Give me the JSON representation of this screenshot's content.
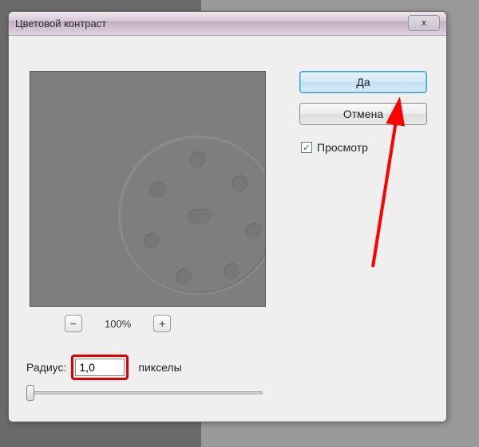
{
  "dialog": {
    "title": "Цветовой контраст",
    "close_icon": "x"
  },
  "zoom": {
    "minus": "−",
    "level": "100%",
    "plus": "+"
  },
  "radius": {
    "label": "Радиус:",
    "value": "1,0",
    "unit": "пикселы"
  },
  "buttons": {
    "ok": "Да",
    "cancel": "Отмена"
  },
  "preview": {
    "checkbox_checked": "✓",
    "label": "Просмотр"
  }
}
